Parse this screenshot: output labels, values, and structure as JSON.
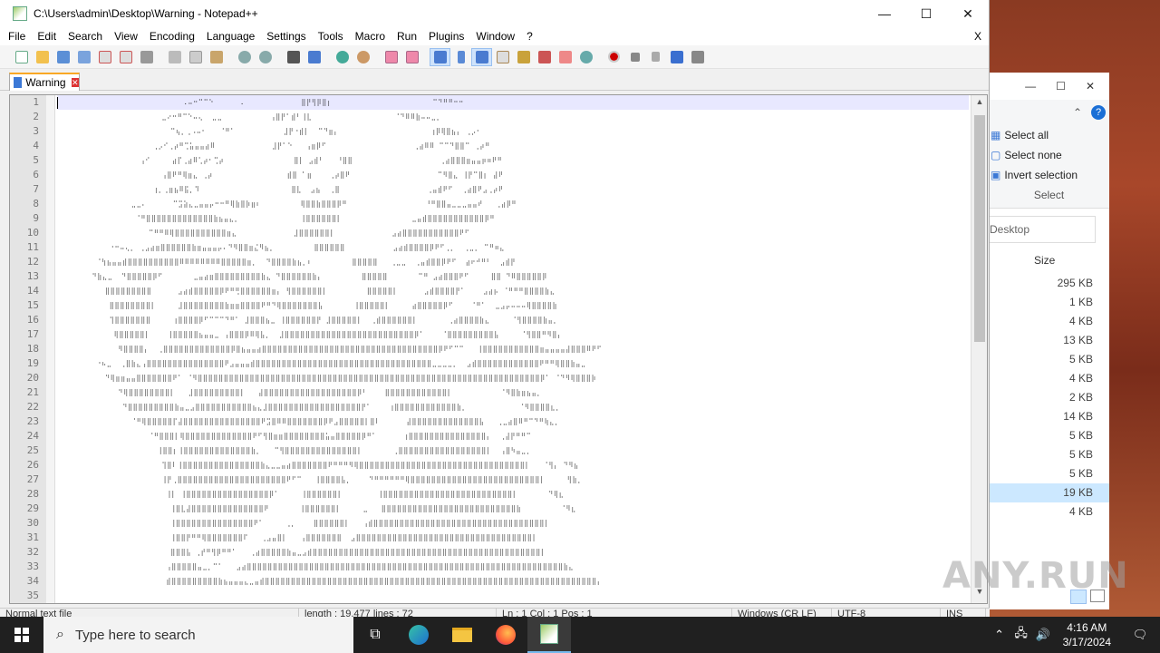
{
  "window": {
    "title": "C:\\Users\\admin\\Desktop\\Warning - Notepad++",
    "minimize": "—",
    "maximize": "☐",
    "close": "✕"
  },
  "menu": [
    "File",
    "Edit",
    "Search",
    "View",
    "Encoding",
    "Language",
    "Settings",
    "Tools",
    "Macro",
    "Run",
    "Plugins",
    "Window",
    "?"
  ],
  "menu_close": "X",
  "tab": {
    "label": "Warning"
  },
  "editor": {
    "line_numbers": [
      "1",
      "2",
      "3",
      "4",
      "5",
      "6",
      "7",
      "8",
      "9",
      "10",
      "11",
      "12",
      "13",
      "14",
      "15",
      "16",
      "17",
      "18",
      "19",
      "20",
      "21",
      "22",
      "23",
      "24",
      "25",
      "26",
      "27",
      "28",
      "29",
      "30",
      "31",
      "32",
      "33",
      "34",
      "35"
    ],
    "lines": [
      "                             .⠤⠒⠉⠉⠑      .             ⣿⡟⢻⡿⣿⡆                       ⠉⠙⠛⠛⠒⠒⠀",
      "                        ⣀⠔⠒⠛⠉⠑⠤⢄  ⣀⣀           ⢠⣿⡟⠁⣾⠃⢸⣇                   ⠈⠙⠿⠿⣷⠤⠤⣀⡀",
      "                          ⠉⢦⡀⢀⠠⠤⠂   ⠈⠛⠁           ⣸⡟⠐⣾⡇  ⠉⠙⣶⡄                     ⢰⡿⢿⣿⣦⡄ ⢀⡠⠂",
      "                      ⢀⡠⠊⢀⡴⠛⢉⣥⣤⣤⣴⠿             ⣸⡟⠁⠑   ⢠⣶⡿⠋                    ⢀⣴⠿⠿ ⠉⠉⠙⣿⣿⠉ ⢀⡴⠛",
      "                   ⢠⠊     ⣴⡏⢀⣴⠿⢁⡴⠂⢉⡴                ⣿⡇ ⣠⣾⠃   ⠘⣿⣿                    ⢀⣴⣿⣿⣿⣶⣤⣤⡶⠶⠟⠛",
      "                        ⢠⣿⠟⠛⢿⣶⣄ ⢀⡴                 ⣾⣿ ⠁⣶    ⢀⡴⣿⠟                    ⠉⠻⣿⣄ ⢸⡟⠉⣿⡆ ⣼⠟",
      "                      ⢰⡀⢀⣶⣦⠿⣯⡀⠹                     ⣿⣇  ⣠⣦  ⢀⣿                    ⢀⣤⣾⠟⠋  ⢀⣴⣿⠟⣠⢀⡴⠟",
      "                 ⣀⣀⠄      ⠉⣩⣵⣄⣀⣤⣤⡤⠒⠒⠛⢿⣷⣿⡷⣶⠆         ⢿⣿⣿⣷⣿⣿⣿⡿⠛                  ⠘⠛⣿⣿⣤⣀⣀⣀⣤⣤⠞   ⢀⣴⡿⠛",
      "                  ⠈⠛⣿⣿⣿⣿⣿⣿⣿⣿⣿⣿⣿⣿⣿⣷⣦⣤⣄⡀              ⢸⣿⣿⣿⣿⣿⣿⡇                ⣀⣤⣾⣿⣿⣿⣿⣿⣿⣿⣿⣿⣿⣿⡿⠛",
      "                     ⠉⠛⠛⠿⢿⣿⣿⣿⣿⣿⣿⣿⣿⣿⣿⣶⣄             ⣸⣿⣿⣿⣿⣿⣿⡇             ⣠⣴⣿⣿⣿⣿⣿⣿⣿⣿⣿⣿⣿⠟⠋",
      "            ⠐⠒⠤⢄⡀ ⢀⣠⣴⣶⣿⣿⣿⣿⣿⣿⣷⣶⣤⣤⣤⡤⠄⠙⠻⣿⣿⣶⣌⠻⣦⡀         ⣿⣿⣿⣿⣿⣿           ⣠⣴⣾⣿⣿⣿⣿⡿⠟⠋⢀⡀  ⢀⣀⡀ ⠉⠛⠶⣄",
      "         ⠈⢳⣦⣤⣤⣾⣿⣿⣿⣿⣿⣿⣿⣿⣿⣿⠿⠿⠿⠿⠿⠿⠿⠿⣿⣿⣿⣿⣿⣶⡀  ⠙⣿⣿⣿⣿⣷⣦⡀⠆         ⣿⣿⣿⣿⣿   ⢀⣀⣀  ⢀⣤⣾⣿⣿⡿⠟⠋  ⣴⠖⠚⠛⠃  ⣠⣾⡟",
      "        ⠙⣷⣄⣀  ⠙⣿⣿⣿⣿⣿⡿⠋       ⣀⣤⣴⣶⣿⣿⣿⣿⣿⣿⣿⣿⣿⣷⣄ ⠙⣿⣿⣿⣿⣿⣿⣷⡄         ⣿⣿⣿⣿⣿       ⠉⠛ ⣠⣴⣿⣿⣿⠟⠋     ⣿⣿ ⠙⠿⣿⣿⣿⣿⣿⡿",
      "           ⣿⣿⣿⣿⣿⣿⣿⣿⣿      ⣠⣴⣾⣿⣿⣿⣿⣿⡿⠟⠛⢛⣿⣿⣿⣿⣿⣿⣶⡄ ⢻⣿⣿⣿⣿⣿⣿⡇         ⣿⣿⣿⣿⣿⡇      ⣠⣾⣿⣿⣿⣿⡟⠁    ⣠⣴⡦ ⠈⠛⠛⠛⣿⣿⣿⣿⣷⣄",
      "            ⣿⣿⣿⣿⣿⣿⣿⣿⡇     ⣸⣿⣿⣿⣿⣿⣿⣿⣿⣷⣶⣶⣿⣿⣿⣿⠟⠛⠙⢿⣿⣿⣿⣿⣿⣿⣿⣧       ⢸⣿⣿⣿⣿⣿⡇     ⣴⣿⣿⣿⣿⣿⡿⠋    ⠈⠛⠁  ⣀⣠⡤⠤⠤⠤⢿⣿⣿⣿⣿⣷",
      "            ⢹⣿⣿⣿⣿⣿⣿⣿     ⢰⣿⣿⣿⣿⡿⠋⠉⠉⠉⠙⠛⠁ ⣸⣿⣿⣿⣦⣀ ⢸⣿⣿⣿⣿⣿⣿⡟ ⣸⣿⣿⣿⣿⣿⡇  ⢀⣾⣿⣿⣿⣿⣿⣿⡇       ⢀⣴⣿⣿⣿⣿⣷⣄     ⠈⢻⣿⣿⣿⣿⣷⣤⡀",
      "             ⢿⣿⣿⣿⣿⣿⡇    ⢸⣿⣿⣿⣿⣿⣦⣤⣤⣀ ⢠⣿⣿⣿⡿⠿⢿⣧⡀  ⣸⣿⣿⣿⣿⣿⣿⣿⣿⣿⣿⣿⣿⣿⣿⣿⣿⣿⣿⣿⣿⣿⣿⣿⣿⣿⡿⠁    ⠈⣿⣿⣿⣿⣿⣿⣿⣿⣿⣧     ⠈⢻⣿⣿⠛⠻⣿⡄",
      "              ⠻⣿⣿⣿⣿⡄  ⢀⣿⣿⣿⣿⣿⣿⣿⣿⣿⣿⣿⣿⣿⡿⣿⣦⣤⣤⣴⣿⣿⣿⣿⣿⣿⣿⣿⣿⣿⣿⣿⣿⣿⣿⣿⣿⣿⣿⣿⣿⣿⣿⣿⣿⣿⣿⣿⣿⣿⣿⣿⣿⣿⡿⠟⠋⠉⠉   ⢸⣿⣿⣿⣿⣿⣿⣿⣿⣿⣿⣿⣶⣤⣤⣤⣤⣼⣿⣿⣿⠿⠟⠋",
      "         ⠐⠦⣀  ⢀⣿⣷⣄⢠⣿⣿⣿⣿⣿⣿⣿⣿⣿⣿⣿⣿⣿⣿⣿⠟⣠⣤⣤⣤⣾⣿⣿⣿⣿⣿⣿⣿⣿⣿⣿⣿⣿⣿⣿⣿⣿⣿⣿⣿⣿⣿⣿⣿⣿⣿⣿⣿⣿⣿⣿⣿⣿⣿⣿⣀⣀⣀⣀⡀  ⣠⣾⣿⣿⣿⣿⣿⣿⣿⣿⣿⣿⣿⣿⠟⠛⠛⢿⣿⣿⣷⣤⣀",
      "           ⠙⢿⣶⣶⣤⣤⣿⣿⣿⣿⣿⣿⣿⠟⠁ ⠈⠻⣿⣿⣿⣿⣿⣿⣿⣿⣿⣿⣿⣿⣿⣿⣿⣿⣿⣿⣿⣿⣿⣿⣿⣿⣿⣿⣿⣿⣿⣿⣿⣿⣿⣿⣿⣿⣿⣿⣿⣿⣿⣿⣿⣿⣿⣿⣿⣿⣿⣿⣿⣿⣿⣿⣿⣿⣿⣿⣿⣿⣿⣿⣿⣿⣿⣿⡿⠁ ⠈⠙⠻⢿⣿⣿⣿⡷",
      "              ⠙⢿⣿⣿⣿⣿⣿⣿⣿⣿⡇   ⣸⣿⣿⣿⣿⣿⣿⣿⣿⣿⡇   ⣼⣿⣿⣿⣿⣿⣿⣿⣿⣿⣿⣿⣿⣿⣿⣿⣿⣿⣿⡿⠃    ⣿⣿⣿⣿⣿⣿⣿⣿⣿⣿⣿⣿⡇           ⠈⠻⣿⣷⣶⣦⣤⡀",
      "               ⠙⣿⣿⣿⣿⣿⣿⣿⣿⣿⣷⣤⣀⣠⣿⣿⣿⣿⣿⣿⣿⣿⣿⣿⣿⣦⣄⣸⣿⣿⣿⣿⣿⣿⣿⣿⣿⣿⣿⣿⣿⣿⣿⣿⣿⣿⡟⠁    ⢰⣿⣿⣿⣿⣿⣿⣿⣿⣿⣿⣿⣿⣷⡀            ⠈⠻⣿⣿⣿⣿⣆⡀",
      "                 ⠈⠛⢿⣿⣿⣿⣿⣿⡏⣼⣿⣿⣿⣿⣿⣿⣿⣿⣿⣿⣿⣿⣿⣿⣿⠟⣩⣿⠿⠿⣿⣿⣿⣿⣿⣿⣿⡿⠟⣠⣿⣿⣿⣿⣿⡇⣿⠇      ⣼⣿⣿⣿⣿⣿⣿⣿⣿⣿⣿⣿⣿⣿⣧   ⢀⣀⣴⣿⠿⠛⠉⠙⠛⢷⣄⡀",
      "                     ⠈⠛⣿⣿⣿⡇⢿⣿⣿⣿⣿⣿⣿⣿⣿⣿⣿⣿⣿⣿⠟⠋⢻⣿⣶⣶⣿⣿⣿⣿⣿⣿⣿⣿⣥⣤⣿⣿⣿⣿⣿⡿⠛⠁      ⢰⣿⣿⣿⣿⣿⣿⣿⣿⣿⣿⣿⣿⣿⣿⣿⡄  ⢀⣼⡟⠛⠛⠉",
      "                       ⢸⣿⣿⡆⢸⣿⣿⣿⣿⣿⣿⣿⣿⣿⣿⣿⣿⣿⣷⡀   ⠉⢻⣿⣿⣿⣿⣿⣿⣿⣿⣿⣿⣿⣿⣿⣿⡇       ⢀⣿⣿⣿⣿⣿⣿⣿⣿⣿⣿⣿⣿⣿⣿⣿⣿⣿⡇  ⢠⣿⠳⣤⣀⡀",
      "                        ⢹⣿⠇⢸⣿⣿⣿⣿⣿⣿⣿⣿⣿⣿⣿⣿⣿⣿⣿⣷⣄⣀⣀⣤⣴⣿⣿⣿⣿⣿⣿⣿⠟⠛⠛⠛⠻⢿⣿⣿⣿⣿⣿⣿⣿⣿⣿⣿⣿⣿⣿⣿⣿⣿⣿⣿⣿⣿⣿⣿⣿⣿⣿⣿⣿⣿⣿⣿⣿⣿⡇   ⠈⢻⡄ ⠙⠻⣦",
      "                        ⢸⡟⢀⣿⣿⣿⣿⣿⣿⣿⣿⣿⣿⣿⣿⣿⣿⣿⣿⣿⣿⣿⣿⣿⠟⠋⠉   ⢸⣿⣿⣿⣿⣧⡀    ⠙⠛⠛⠛⠛⠛⠛⢿⣿⣿⣿⣿⣿⣿⣿⣿⣿⣿⣿⣿⣿⣿⣿⣿⣿⣿⣿⣿⣿⣿⣿⣿⣿⡇     ⢻⣷⡀",
      "                         ⢸⡇ ⢸⣿⣿⣿⣿⣿⣿⣿⣿⣿⣿⣿⣿⣿⣿⣿⣿⡿⠁     ⢸⣿⣿⣿⣿⣿⣿⡇        ⢸⣿⣿⣿⣿⣿⣿⣿⣿⣿⣿⣿⣿⣿⣿⣿⣿⣿⣿⣿⣿⣿⣿⣿⣿⣿⡇       ⠙⢿⣆",
      "                          ⢸⣿⣇⣼⣿⣿⣿⣿⣿⣿⣿⣿⣿⣿⣿⣿⣿⣿⠟       ⢸⣿⣿⣿⣿⣿⣿⡇     ⣀   ⣿⣿⣿⣿⣿⣿⣿⣿⣿⣿⣿⣿⣿⣿⣿⣿⣿⣿⣿⣿⣿⣿⣿⣿⣿⣿⣷         ⠈⠻⣆",
      "                          ⢸⣿⣿⣿⣿⣿⣿⣿⣿⣿⣿⣿⣿⣿⣿⣿⠟⠁     ⢀⡀    ⣿⣿⣿⣿⣿⣿⡇   ⢠⣾⣿⣿⣿⣿⣿⣿⣿⣿⣿⣿⣿⣿⣿⣿⣿⣿⣿⣿⣿⣿⣿⣿⣿⣿⣿⣿⣿⣿⣿⣿⣿⣿⣿⡇",
      "                          ⢸⣿⣿⡟⠛⠛⢿⣿⣿⣿⣿⣿⣿⣿⠏   ⢀⣠⣤⣿⡇   ⢠⣿⣿⣿⣿⣿⣿⣿  ⣠⣿⣿⣿⣿⣿⣿⣿⣿⣿⣿⣿⣿⣿⣿⣿⣿⣿⣿⣿⣿⣿⣿⣿⣿⣿⣿⣿⣿⣿⣿⣿⣿⣿⣿⡇",
      "                          ⣿⣿⣿⣧ ⢀⡞⠛⢻⡿⠛⠛⠁   ⢀⣴⣿⣿⣿⣿⣿⣷⣤⣀⣠⣾⣿⣿⣿⣿⣿⣿⣿⣿⣿⣿⣿⣿⣿⣿⣿⣿⣿⣿⣿⣿⣿⣿⣿⣿⣿⣿⣿⣿⣿⣿⣿⣿⣿⣿⣿⣿⣿⣿⣿⣿⣿⣿⣿⣿⡇",
      "                         ⢠⣿⣿⣿⣿⣿⣤⣀⡀⠉⠁   ⣠⣴⣿⣿⣿⣿⣿⣿⣿⣿⣿⣿⣿⣿⣿⣿⣿⣿⣿⣿⣿⣿⣿⣿⣿⣿⣿⣿⣿⣿⣿⣿⣿⣿⣿⣿⣿⣿⣿⣿⣿⣿⣿⣿⣿⣿⣿⣿⣿⣿⣿⣿⣿⣿⣿⣿⣿⣿⣿⣿⣿⣿⣿⣷⣄",
      "                         ⣾⣿⣿⣿⣿⣿⣿⣿⣿⣿⣷⣦⣤⣤⣤⣄⣀⣤⣾⣿⣿⣿⣿⣿⣿⣿⣿⣿⣿⣿⣿⣿⣿⣿⣿⣿⣿⣿⣿⣿⣿⣿⣿⣿⣿⣿⣿⣿⣿⣿⣿⣿⣿⣿⣿⣿⣿⣿⣿⣿⣿⣿⣿⣿⣿⣿⣿⣿⣿⣿⣿⣿⣿⣿⣿⣿⣿⣿⣿⣿⣿⣿⣿⡄"
    ]
  },
  "statusbar": {
    "type": "Normal text file",
    "length": "length : 19,477    lines : 72",
    "pos": "Ln : 1    Col : 1    Pos : 1",
    "eol": "Windows (CR LF)",
    "enc": "UTF-8",
    "mode": "INS"
  },
  "explorer": {
    "ribbon": [
      "Select all",
      "Select none",
      "Invert selection"
    ],
    "group_label": "Select",
    "path": "Desktop",
    "column": "Size",
    "sizes": [
      "295 KB",
      "1 KB",
      "4 KB",
      "13 KB",
      "5 KB",
      "4 KB",
      "2 KB",
      "14 KB",
      "5 KB",
      "5 KB",
      "5 KB",
      "19 KB",
      "4 KB"
    ],
    "selected_index": 11
  },
  "taskbar": {
    "search_placeholder": "Type here to search",
    "time": "4:16 AM",
    "date": "3/17/2024"
  },
  "watermark": "ANY.RUN",
  "colors": {
    "taskbar": "#202020",
    "tab_accent": "#f9a825",
    "current_line": "#e8e8ff"
  }
}
